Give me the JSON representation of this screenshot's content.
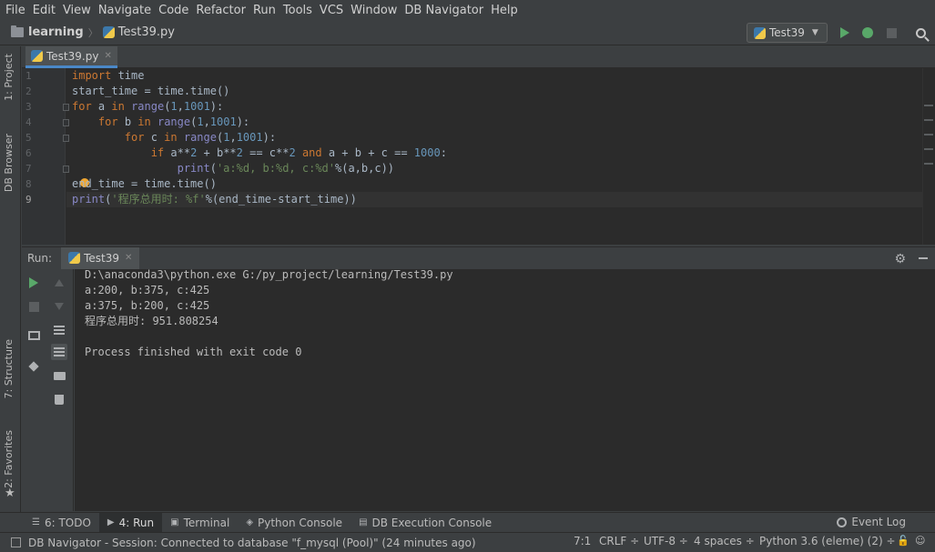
{
  "menu": [
    "File",
    "Edit",
    "View",
    "Navigate",
    "Code",
    "Refactor",
    "Run",
    "Tools",
    "VCS",
    "Window",
    "DB Navigator",
    "Help"
  ],
  "breadcrumb": {
    "project": "learning",
    "file": "Test39.py"
  },
  "run_config": {
    "name": "Test39"
  },
  "left_tabs": {
    "project": "1: Project",
    "db_browser": "DB Browser",
    "structure": "7: Structure",
    "favorites": "2: Favorites"
  },
  "editor": {
    "tab_label": "Test39.py",
    "line_numbers": [
      "1",
      "2",
      "3",
      "4",
      "5",
      "6",
      "7",
      "8",
      "9"
    ],
    "lines": [
      "import time",
      "start_time = time.time()",
      "for a in range(1,1001):",
      "    for b in range(1,1001):",
      "        for c in range(1,1001):",
      "            if a**2 + b**2 == c**2 and a + b + c == 1000:",
      "                print('a:%d, b:%d, c:%d'%(a,b,c))",
      "end_time = time.time()",
      "print('程序总用时: %f'%(end_time-start_time))"
    ],
    "current_line": 9
  },
  "run_panel": {
    "label": "Run:",
    "tab_label": "Test39",
    "console": [
      "D:\\anaconda3\\python.exe G:/py_project/learning/Test39.py",
      "a:200, b:375, c:425",
      "a:375, b:200, c:425",
      "程序总用时: 951.808254",
      "",
      "Process finished with exit code 0"
    ]
  },
  "tool_tabs": {
    "todo": "6: TODO",
    "run": "4: Run",
    "terminal": "Terminal",
    "python_console": "Python Console",
    "db_console": "DB Execution Console",
    "event_log": "Event Log"
  },
  "status": {
    "message": "DB Navigator - Session: Connected to database \"f_mysql (Pool)\" (24 minutes ago)",
    "position": "7:1",
    "line_ending": "CRLF ÷",
    "encoding": "UTF-8 ÷",
    "indent": "4 spaces ÷",
    "interpreter": "Python 3.6 (eleme) (2) ÷"
  },
  "colors": {
    "accent": "#4a88c7",
    "run_green": "#59a869",
    "editor_bg": "#2b2b2b",
    "panel_bg": "#3c3f41"
  }
}
